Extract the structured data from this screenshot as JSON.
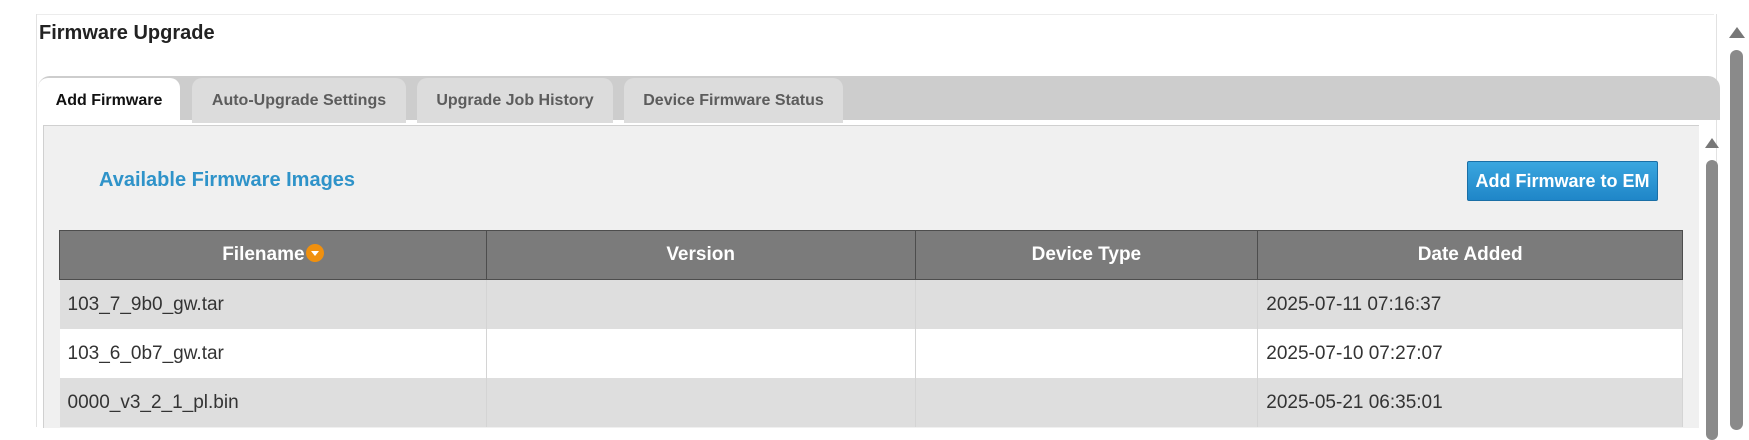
{
  "page_title": "Firmware Upgrade",
  "tabs": [
    {
      "label": "Add Firmware",
      "active": true
    },
    {
      "label": "Auto-Upgrade Settings",
      "active": false
    },
    {
      "label": "Upgrade Job History",
      "active": false
    },
    {
      "label": "Device Firmware Status",
      "active": false
    }
  ],
  "section": {
    "title": "Available Firmware Images",
    "add_button_label": "Add Firmware to EM"
  },
  "table": {
    "columns": [
      "Filename",
      "Version",
      "Device Type",
      "Date Added"
    ],
    "sort_icon": "sort-desc-icon",
    "rows": [
      {
        "filename": "103_7_9b0_gw.tar",
        "version": "",
        "device_type": "",
        "date_added": "2025-07-11 07:16:37"
      },
      {
        "filename": "103_6_0b7_gw.tar",
        "version": "",
        "device_type": "",
        "date_added": "2025-07-10 07:27:07"
      },
      {
        "filename": "0000_v3_2_1_pl.bin",
        "version": "",
        "device_type": "",
        "date_added": "2025-05-21 06:35:01"
      }
    ]
  },
  "colors": {
    "accent": "#2f93c9",
    "button": "#1f86c8",
    "header_bg": "#7b7b7b",
    "sort_icon": "#f0900e"
  }
}
